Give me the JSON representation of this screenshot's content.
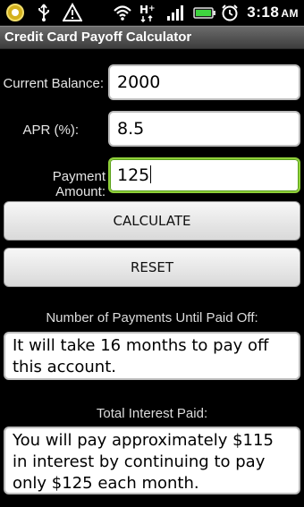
{
  "status_bar": {
    "time": "3:18",
    "ampm": "AM",
    "icons": [
      "android-notification-icon",
      "usb-icon",
      "warning-icon",
      "wifi-icon",
      "h-plus-data-icon",
      "signal-bars-icon",
      "battery-icon",
      "alarm-icon"
    ]
  },
  "app": {
    "title": "Credit Card Payoff Calculator"
  },
  "form": {
    "balance_label": "Current Balance:",
    "balance_value": "2000",
    "apr_label": "APR (%):",
    "apr_value": "8.5",
    "payment_label": "Payment Amount:",
    "payment_value": "125"
  },
  "buttons": {
    "calculate": "CALCULATE",
    "reset": "RESET"
  },
  "results": {
    "payments_label": "Number of Payments Until Paid Off:",
    "payments_text": "It will take 16 months to pay off this account.",
    "interest_label": "Total Interest Paid:",
    "interest_text": "You will pay approximately $115 in interest by continuing to pay only $125 each month."
  },
  "colors": {
    "background": "#000000",
    "focus_border": "#8fcf3a"
  }
}
